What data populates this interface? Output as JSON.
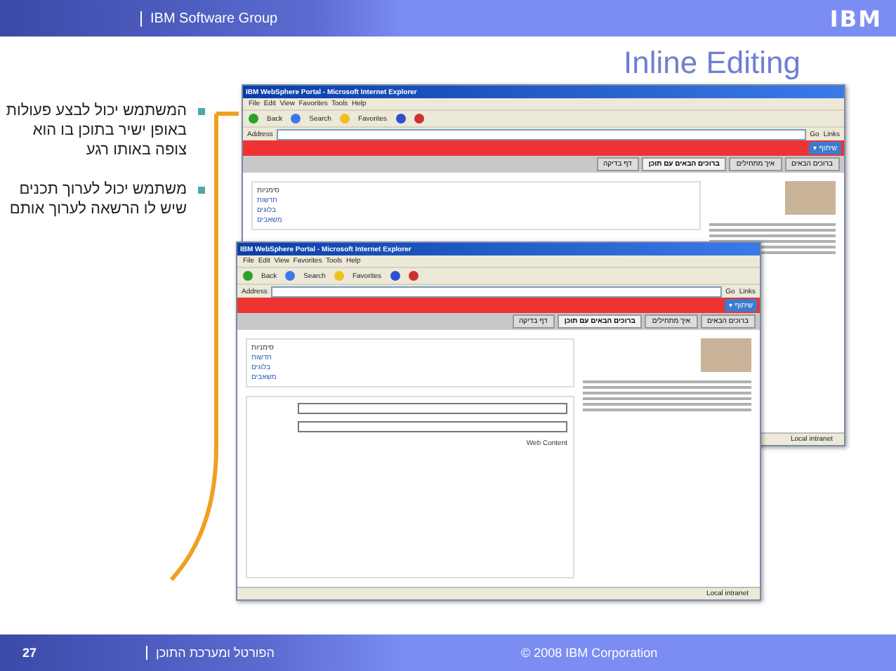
{
  "header": {
    "group": "IBM Software Group",
    "logo": "IBM"
  },
  "title": "Inline Editing",
  "bullets": [
    "המשתמש יכול לבצע פעולות באופן ישיר בתוכן בו הוא צופה באותו רגע",
    "משתמש יכול לערוך תכנים שיש לו הרשאה לערוך אותם"
  ],
  "windows": [
    {
      "title": "IBM WebSphere Portal - Microsoft Internet Explorer",
      "menu": "File  Edit  View  Favorites  Tools  Help",
      "back": "Back",
      "search": "Search",
      "favorites": "Favorites",
      "address_label": "Address",
      "go": "Go",
      "links": "Links",
      "top_menu": "שיתוף ▾",
      "tabs": [
        {
          "label": "ברוכים הבאים",
          "selected": false
        },
        {
          "label": "איך מתחילים",
          "selected": false
        },
        {
          "label": "ברוכים הבאים עם תוכן",
          "selected": true
        },
        {
          "label": "דף בדיקה",
          "selected": false
        }
      ],
      "panel_title": "סימניות",
      "folders": [
        "חדשות",
        "בלוגים",
        "משאבים"
      ],
      "form": false,
      "status": "Local intranet"
    },
    {
      "title": "IBM WebSphere Portal - Microsoft Internet Explorer",
      "menu": "File  Edit  View  Favorites  Tools  Help",
      "back": "Back",
      "search": "Search",
      "favorites": "Favorites",
      "address_label": "Address",
      "go": "Go",
      "links": "Links",
      "top_menu": "שיתוף ▾",
      "tabs": [
        {
          "label": "ברוכים הבאים",
          "selected": false
        },
        {
          "label": "איך מתחילים",
          "selected": false
        },
        {
          "label": "ברוכים הבאים עם תוכן",
          "selected": true
        },
        {
          "label": "דף בדיקה",
          "selected": false
        }
      ],
      "panel_title": "סימניות",
      "folders": [
        "חדשות",
        "בלוגים",
        "משאבים"
      ],
      "form": true,
      "form_value": "Web Content",
      "status": "Local intranet"
    }
  ],
  "footer": {
    "page": "27",
    "section": "הפורטל ומערכת התוכן",
    "copyright": "© 2008 IBM Corporation"
  }
}
